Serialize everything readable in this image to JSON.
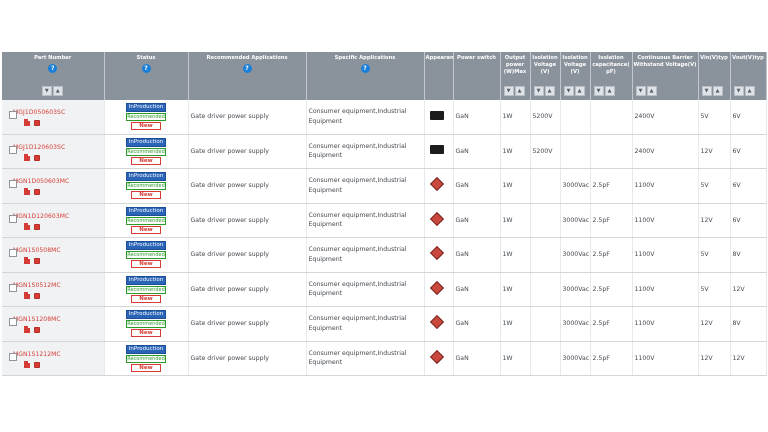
{
  "headers": [
    {
      "label": "Part Number",
      "help": "?",
      "sort": true
    },
    {
      "label": "Status",
      "help": "?",
      "sort": false
    },
    {
      "label": "Recommended Applications",
      "help": "?",
      "sort": false
    },
    {
      "label": "Specific Applications",
      "help": "?",
      "sort": false
    },
    {
      "label": "Appearance",
      "help": "",
      "sort": false
    },
    {
      "label": "Power switch",
      "help": "",
      "sort": false
    },
    {
      "label": "Output power (W)Max",
      "help": "",
      "sort": true
    },
    {
      "label": "Isolation Voltage (V)",
      "help": "",
      "sort": true
    },
    {
      "label": "Isolation Voltage (V)",
      "help": "",
      "sort": true
    },
    {
      "label": "Isolation capacitance( pF)",
      "help": "",
      "sort": true
    },
    {
      "label": "Continuous Barrier Withstand Voltage(V)",
      "help": "",
      "sort": true
    },
    {
      "label": "Vin(V)typ",
      "help": "",
      "sort": true
    },
    {
      "label": "Vout(V)typ",
      "help": "",
      "sort": true
    }
  ],
  "sort_labels": {
    "down": "▼",
    "up": "▲"
  },
  "status": {
    "production": "InProduction",
    "recommended": "Recommended",
    "new": "New"
  },
  "rows": [
    {
      "part": "MGJ1D050603SC",
      "rec_app": "Gate driver power supply",
      "spec_app": "Consumer equipment,Industrial Equipment",
      "appearance": "dip",
      "switch": "GaN",
      "power": "1W",
      "iso1": "5200V",
      "iso2": "",
      "cap": "",
      "barrier": "2400V",
      "vin": "5V",
      "vout": "6V"
    },
    {
      "part": "MGJ1D120603SC",
      "rec_app": "Gate driver power supply",
      "spec_app": "Consumer equipment,Industrial Equipment",
      "appearance": "dip",
      "switch": "GaN",
      "power": "1W",
      "iso1": "5200V",
      "iso2": "",
      "cap": "",
      "barrier": "2400V",
      "vin": "12V",
      "vout": "6V"
    },
    {
      "part": "MGN1D050603MC",
      "rec_app": "Gate driver power supply",
      "spec_app": "Consumer equipment,Industrial Equipment",
      "appearance": "smd",
      "switch": "GaN",
      "power": "1W",
      "iso1": "",
      "iso2": "3000Vac",
      "cap": "2.5pF",
      "barrier": "1100V",
      "vin": "5V",
      "vout": "6V"
    },
    {
      "part": "MGN1D120603MC",
      "rec_app": "Gate driver power supply",
      "spec_app": "Consumer equipment,Industrial Equipment",
      "appearance": "smd",
      "switch": "GaN",
      "power": "1W",
      "iso1": "",
      "iso2": "3000Vac",
      "cap": "2.5pF",
      "barrier": "1100V",
      "vin": "12V",
      "vout": "6V"
    },
    {
      "part": "MGN1S0508MC",
      "rec_app": "Gate driver power supply",
      "spec_app": "Consumer equipment,Industrial Equipment",
      "appearance": "smd",
      "switch": "GaN",
      "power": "1W",
      "iso1": "",
      "iso2": "3000Vac",
      "cap": "2.5pF",
      "barrier": "1100V",
      "vin": "5V",
      "vout": "8V"
    },
    {
      "part": "MGN1S0512MC",
      "rec_app": "Gate driver power supply",
      "spec_app": "Consumer equipment,Industrial Equipment",
      "appearance": "smd",
      "switch": "GaN",
      "power": "1W",
      "iso1": "",
      "iso2": "3000Vac",
      "cap": "2.5pF",
      "barrier": "1100V",
      "vin": "5V",
      "vout": "12V"
    },
    {
      "part": "MGN1S1208MC",
      "rec_app": "Gate driver power supply",
      "spec_app": "Consumer equipment,Industrial Equipment",
      "appearance": "smd",
      "switch": "GaN",
      "power": "1W",
      "iso1": "",
      "iso2": "3000Vac",
      "cap": "2.5pF",
      "barrier": "1100V",
      "vin": "12V",
      "vout": "8V"
    },
    {
      "part": "MGN1S1212MC",
      "rec_app": "Gate driver power supply",
      "spec_app": "Consumer equipment,Industrial Equipment",
      "appearance": "smd",
      "switch": "GaN",
      "power": "1W",
      "iso1": "",
      "iso2": "3000Vac",
      "cap": "2.5pF",
      "barrier": "1100V",
      "vin": "12V",
      "vout": "12V"
    }
  ],
  "icons": {
    "datasheet": "pdf-icon",
    "model": "3d-model-icon",
    "appearance_dip": "dip-package-icon",
    "appearance_smd": "smd-package-icon"
  },
  "colors": {
    "header_bg": "#8a929b",
    "part_link": "#d43c35",
    "production": "#2a64b7",
    "recommended": "#2b9a2b",
    "new": "#d43c35"
  }
}
